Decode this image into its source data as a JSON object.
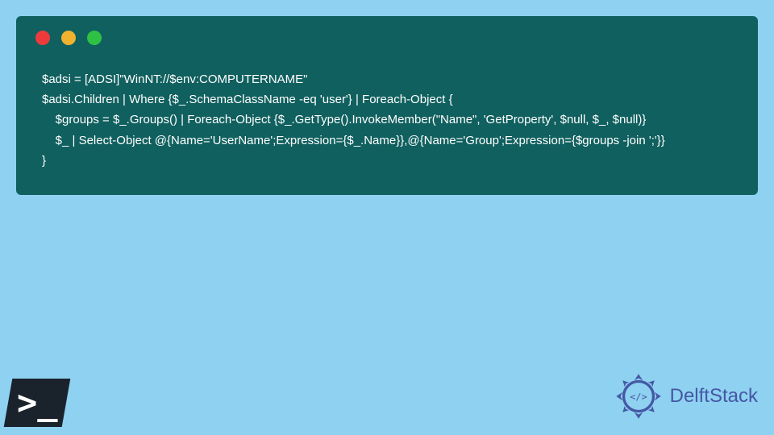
{
  "code": {
    "line1": "$adsi = [ADSI]\"WinNT://$env:COMPUTERNAME\"",
    "line2": "$adsi.Children | Where {$_.SchemaClassName -eq 'user'} | Foreach-Object {",
    "line3": "    $groups = $_.Groups() | Foreach-Object {$_.GetType().InvokeMember(\"Name\", 'GetProperty', $null, $_, $null)}",
    "line4": "    $_ | Select-Object @{Name='UserName';Expression={$_.Name}},@{Name='Group';Expression={$groups -join ';'}}",
    "line5": "}"
  },
  "branding": {
    "delftstack": "DelftStack",
    "ps_prompt": ">_"
  },
  "colors": {
    "background": "#8ed1f0",
    "window_bg": "#10605f",
    "code_text": "#ffffff",
    "brand_blue": "#4557a5"
  }
}
